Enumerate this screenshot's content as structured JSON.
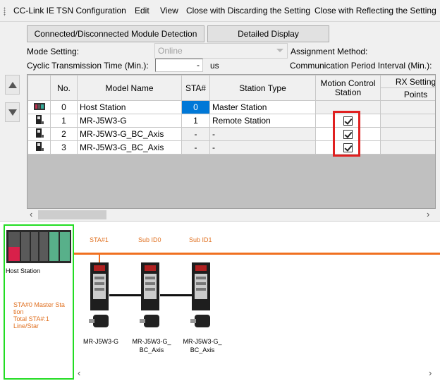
{
  "menu": {
    "title": "CC-Link IE TSN Configuration",
    "edit": "Edit",
    "view": "View",
    "close_discard": "Close with Discarding the Setting",
    "close_reflect": "Close with Reflecting the Setting"
  },
  "toolbar": {
    "detect_button": "Connected/Disconnected Module Detection",
    "detail_button": "Detailed Display"
  },
  "settings": {
    "mode_label": "Mode Setting:",
    "mode_value": "Online",
    "assignment_label": "Assignment Method:",
    "cyclic_label": "Cyclic Transmission Time (Min.):",
    "cyclic_value": "-",
    "cyclic_unit": "us",
    "comm_period_label": "Communication Period Interval (Min.):"
  },
  "table": {
    "headers": {
      "no": "No.",
      "model": "Model Name",
      "sta": "STA#",
      "station_type": "Station Type",
      "motion1": "Motion Control",
      "motion2": "Station",
      "rx": "RX Setting",
      "points": "Points"
    },
    "rows": [
      {
        "no": "0",
        "model": "Host Station",
        "sta": "0",
        "type": "Master Station",
        "motion": false
      },
      {
        "no": "1",
        "model": "MR-J5W3-G",
        "sta": "1",
        "type": "Remote Station",
        "motion": true
      },
      {
        "no": "2",
        "model": "MR-J5W3-G_BC_Axis",
        "sta": "-",
        "type": "-",
        "motion": true
      },
      {
        "no": "3",
        "model": "MR-J5W3-G_BC_Axis",
        "sta": "-",
        "type": "-",
        "motion": true
      }
    ]
  },
  "diagram": {
    "host_label": "Host Station",
    "sta1_label": "STA#1",
    "subid0_label": "Sub ID0",
    "subid1_label": "Sub ID1",
    "host_info": [
      "STA#0  Master Sta",
      "tion",
      "Total STA#:1",
      "Line/Star"
    ],
    "servo1": [
      "MR-J5W3-G"
    ],
    "servo2": [
      "MR-J5W3-G_",
      "BC_Axis"
    ],
    "servo3": [
      "MR-J5W3-G_",
      "BC_Axis"
    ]
  },
  "colors": {
    "highlight_red": "#e02020",
    "host_green": "#22dd22",
    "network_orange": "#f07020",
    "sta_blue": "#0078d7"
  }
}
